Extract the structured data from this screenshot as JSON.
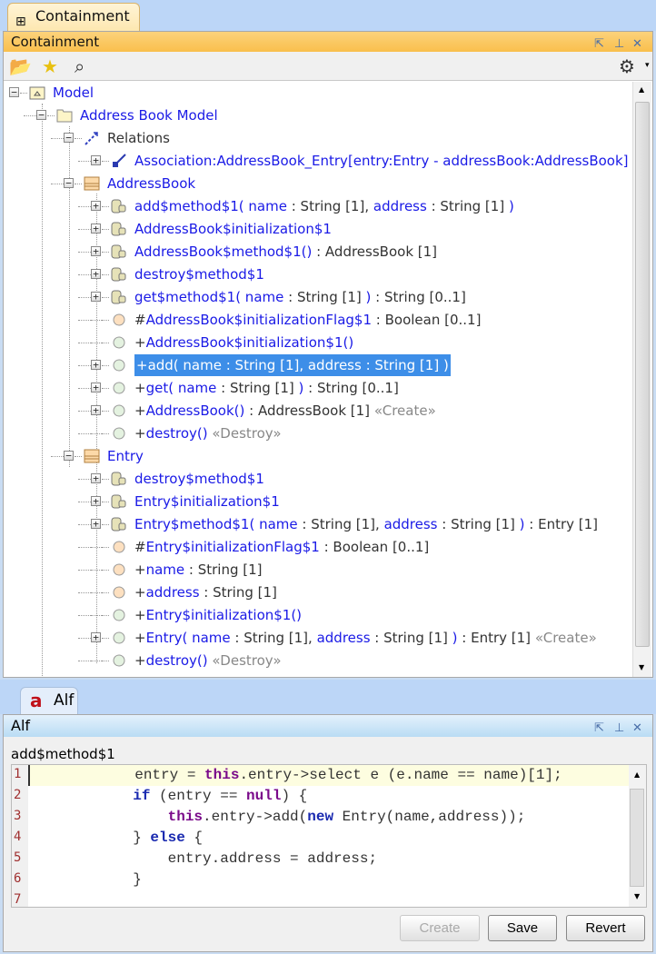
{
  "top_tab": {
    "label": "Containment",
    "icon": "containment-tree-icon"
  },
  "containment": {
    "title": "Containment",
    "toolbar": {
      "open": "open-folder-icon",
      "favorite": "star-icon",
      "search": "search-icon",
      "settings": "gear-icon"
    },
    "rows": [
      {
        "level": 0,
        "toggle": "minus",
        "icon": "model",
        "segs": [
          {
            "t": "Model",
            "c": "b"
          }
        ]
      },
      {
        "level": 1,
        "toggle": "minus",
        "icon": "package",
        "segs": [
          {
            "t": "Address Book Model",
            "c": "b"
          }
        ]
      },
      {
        "level": 2,
        "toggle": "minus",
        "icon": "relations",
        "segs": [
          {
            "t": "Relations",
            "c": "k"
          }
        ]
      },
      {
        "level": 3,
        "toggle": "plus",
        "icon": "association",
        "segs": [
          {
            "t": "Association:AddressBook_Entry[entry:Entry - addressBook:AddressBook]",
            "c": "b"
          }
        ]
      },
      {
        "level": 2,
        "toggle": "minus",
        "icon": "class",
        "segs": [
          {
            "t": "AddressBook",
            "c": "b"
          }
        ]
      },
      {
        "level": 3,
        "toggle": "plus",
        "icon": "activity",
        "segs": [
          {
            "t": "add$method$1( name",
            "c": "b"
          },
          {
            "t": " : String [1], ",
            "c": "k"
          },
          {
            "t": "address",
            "c": "b"
          },
          {
            "t": " : String [1] ",
            "c": "k"
          },
          {
            "t": ")",
            "c": "b"
          }
        ]
      },
      {
        "level": 3,
        "toggle": "plus",
        "icon": "activity",
        "segs": [
          {
            "t": "AddressBook$initialization$1",
            "c": "b"
          }
        ]
      },
      {
        "level": 3,
        "toggle": "plus",
        "icon": "activity",
        "segs": [
          {
            "t": "AddressBook$method$1()",
            "c": "b"
          },
          {
            "t": " : AddressBook [1]",
            "c": "k"
          }
        ]
      },
      {
        "level": 3,
        "toggle": "plus",
        "icon": "activity",
        "segs": [
          {
            "t": "destroy$method$1",
            "c": "b"
          }
        ]
      },
      {
        "level": 3,
        "toggle": "plus",
        "icon": "activity",
        "segs": [
          {
            "t": "get$method$1( name",
            "c": "b"
          },
          {
            "t": " : String [1] ",
            "c": "k"
          },
          {
            "t": ")",
            "c": "b"
          },
          {
            "t": " : String [0..1]",
            "c": "k"
          }
        ]
      },
      {
        "level": 3,
        "toggle": "none",
        "icon": "property",
        "segs": [
          {
            "t": "#",
            "c": "k"
          },
          {
            "t": "AddressBook$initializationFlag$1",
            "c": "b"
          },
          {
            "t": " : Boolean [0..1]",
            "c": "k"
          }
        ]
      },
      {
        "level": 3,
        "toggle": "none",
        "icon": "operation",
        "segs": [
          {
            "t": "+",
            "c": "k"
          },
          {
            "t": "AddressBook$initialization$1()",
            "c": "b"
          }
        ]
      },
      {
        "level": 3,
        "toggle": "plus",
        "icon": "operation",
        "selected": true,
        "segs": [
          {
            "t": "+add( name : String [1], address : String [1] )",
            "c": "k"
          }
        ]
      },
      {
        "level": 3,
        "toggle": "plus",
        "icon": "operation",
        "segs": [
          {
            "t": "+",
            "c": "k"
          },
          {
            "t": "get( name",
            "c": "b"
          },
          {
            "t": " : String [1] ",
            "c": "k"
          },
          {
            "t": ")",
            "c": "b"
          },
          {
            "t": " : String [0..1]",
            "c": "k"
          }
        ]
      },
      {
        "level": 3,
        "toggle": "plus",
        "icon": "operation",
        "segs": [
          {
            "t": "+",
            "c": "k"
          },
          {
            "t": "AddressBook()",
            "c": "b"
          },
          {
            "t": " : AddressBook [1] ",
            "c": "k"
          },
          {
            "t": "«Create»",
            "c": "g"
          }
        ]
      },
      {
        "level": 3,
        "toggle": "none",
        "icon": "operation",
        "segs": [
          {
            "t": "+",
            "c": "k"
          },
          {
            "t": "destroy()",
            "c": "b"
          },
          {
            "t": " «Destroy»",
            "c": "g"
          }
        ]
      },
      {
        "level": 2,
        "toggle": "minus",
        "icon": "class",
        "segs": [
          {
            "t": "Entry",
            "c": "b"
          }
        ]
      },
      {
        "level": 3,
        "toggle": "plus",
        "icon": "activity",
        "segs": [
          {
            "t": "destroy$method$1",
            "c": "b"
          }
        ]
      },
      {
        "level": 3,
        "toggle": "plus",
        "icon": "activity",
        "segs": [
          {
            "t": "Entry$initialization$1",
            "c": "b"
          }
        ]
      },
      {
        "level": 3,
        "toggle": "plus",
        "icon": "activity",
        "segs": [
          {
            "t": "Entry$method$1( name",
            "c": "b"
          },
          {
            "t": " : String [1], ",
            "c": "k"
          },
          {
            "t": "address",
            "c": "b"
          },
          {
            "t": " : String [1] ",
            "c": "k"
          },
          {
            "t": ")",
            "c": "b"
          },
          {
            "t": " : Entry [1]",
            "c": "k"
          }
        ]
      },
      {
        "level": 3,
        "toggle": "none",
        "icon": "property",
        "segs": [
          {
            "t": "#",
            "c": "k"
          },
          {
            "t": "Entry$initializationFlag$1",
            "c": "b"
          },
          {
            "t": " : Boolean [0..1]",
            "c": "k"
          }
        ]
      },
      {
        "level": 3,
        "toggle": "none",
        "icon": "property",
        "segs": [
          {
            "t": "+",
            "c": "k"
          },
          {
            "t": "name",
            "c": "b"
          },
          {
            "t": " : String [1]",
            "c": "k"
          }
        ]
      },
      {
        "level": 3,
        "toggle": "none",
        "icon": "property",
        "segs": [
          {
            "t": "+",
            "c": "k"
          },
          {
            "t": "address",
            "c": "b"
          },
          {
            "t": " : String [1]",
            "c": "k"
          }
        ]
      },
      {
        "level": 3,
        "toggle": "none",
        "icon": "operation",
        "segs": [
          {
            "t": "+",
            "c": "k"
          },
          {
            "t": "Entry$initialization$1()",
            "c": "b"
          }
        ]
      },
      {
        "level": 3,
        "toggle": "plus",
        "icon": "operation",
        "segs": [
          {
            "t": "+",
            "c": "k"
          },
          {
            "t": "Entry( name",
            "c": "b"
          },
          {
            "t": " : String [1], ",
            "c": "k"
          },
          {
            "t": "address",
            "c": "b"
          },
          {
            "t": " : String [1] ",
            "c": "k"
          },
          {
            "t": ")",
            "c": "b"
          },
          {
            "t": " : Entry [1] ",
            "c": "k"
          },
          {
            "t": "«Create»",
            "c": "g"
          }
        ]
      },
      {
        "level": 3,
        "toggle": "none",
        "icon": "operation",
        "segs": [
          {
            "t": "+",
            "c": "k"
          },
          {
            "t": "destroy()",
            "c": "b"
          },
          {
            "t": " «Destroy»",
            "c": "g"
          }
        ]
      }
    ]
  },
  "alf_tab": {
    "label": "Alf",
    "icon": "alf-icon"
  },
  "alf": {
    "title": "Alf",
    "element_name": "add$method$1",
    "lines": [
      [
        {
          "t": "            entry = "
        },
        {
          "t": "this",
          "k": "kw1"
        },
        {
          "t": ".entry->select e (e.name == name)[1];"
        }
      ],
      [
        {
          "t": "            "
        },
        {
          "t": "if",
          "k": "kw2"
        },
        {
          "t": " (entry == "
        },
        {
          "t": "null",
          "k": "kw1"
        },
        {
          "t": ") {"
        }
      ],
      [
        {
          "t": "                "
        },
        {
          "t": "this",
          "k": "kw1"
        },
        {
          "t": ".entry->add("
        },
        {
          "t": "new",
          "k": "kw2"
        },
        {
          "t": " Entry(name,address));"
        }
      ],
      [
        {
          "t": "            } "
        },
        {
          "t": "else",
          "k": "kw2"
        },
        {
          "t": " {"
        }
      ],
      [
        {
          "t": "                entry.address = address;"
        }
      ],
      [
        {
          "t": "            }"
        }
      ],
      [
        {
          "t": ""
        }
      ]
    ],
    "buttons": {
      "create": "Create",
      "save": "Save",
      "revert": "Revert"
    }
  }
}
